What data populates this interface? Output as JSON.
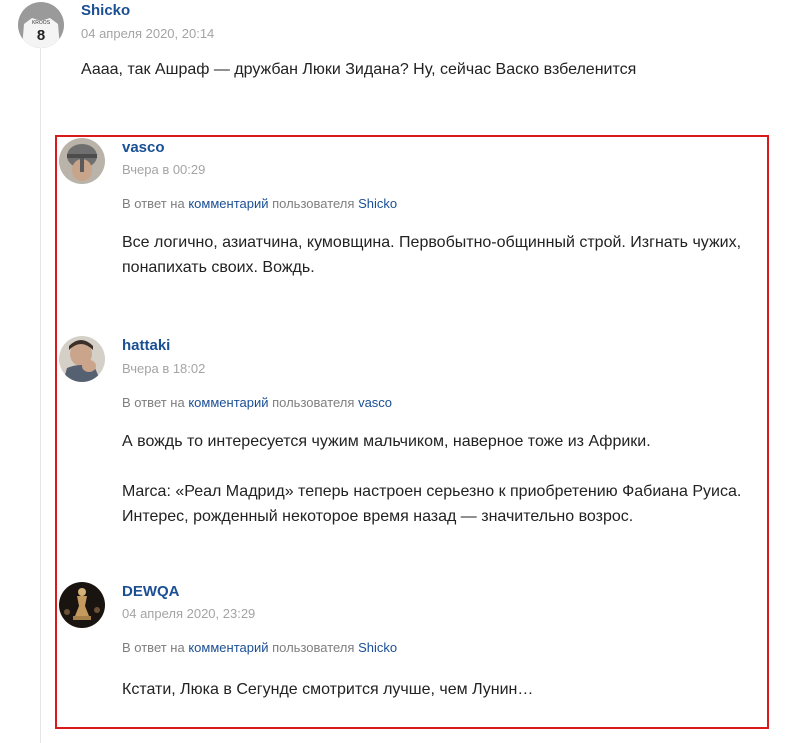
{
  "comments": [
    {
      "author": "Shicko",
      "date": "04 апреля 2020, 20:14",
      "avatar_number": "8",
      "avatar_name": "KROOS",
      "text": "Аааа, так Ашраф — дружбан Люки Зидана? Ну, сейчас Васко взбеленится"
    },
    {
      "author": "vasco",
      "date": "Вчера в 00:29",
      "reply_prefix": "В ответ на",
      "reply_link": "комментарий",
      "reply_mid": "пользователя",
      "reply_user": "Shicko",
      "text_line1": "Все логично, азиатчина, кумовщина. Первобытно-общинный строй. Изгнать чужих,",
      "text_line2": "понапихать своих. Вождь."
    },
    {
      "author": "hattaki",
      "date": "Вчера в 18:02",
      "reply_prefix": "В ответ на",
      "reply_link": "комментарий",
      "reply_mid": "пользователя",
      "reply_user": "vasco",
      "text_p1": "А вождь то интересуется чужим мальчиком, наверное тоже из Африки.",
      "text_p2_line1": "Marca: «Реал Мадрид» теперь настроен серьезно к приобретению Фабиана Руиса.",
      "text_p2_line2": "Интерес, рожденный некоторое время назад — значительно возрос."
    },
    {
      "author": "DEWQA",
      "date": "04 апреля 2020, 23:29",
      "reply_prefix": "В ответ на",
      "reply_link": "комментарий",
      "reply_mid": "пользователя",
      "reply_user": "Shicko",
      "text": "Кстати, Люка в Сегунде смотрится лучше, чем Лунин…"
    }
  ],
  "colors": {
    "link": "#1a4f94",
    "date": "#a4a4a4",
    "highlight_border": "#d91a1a"
  }
}
